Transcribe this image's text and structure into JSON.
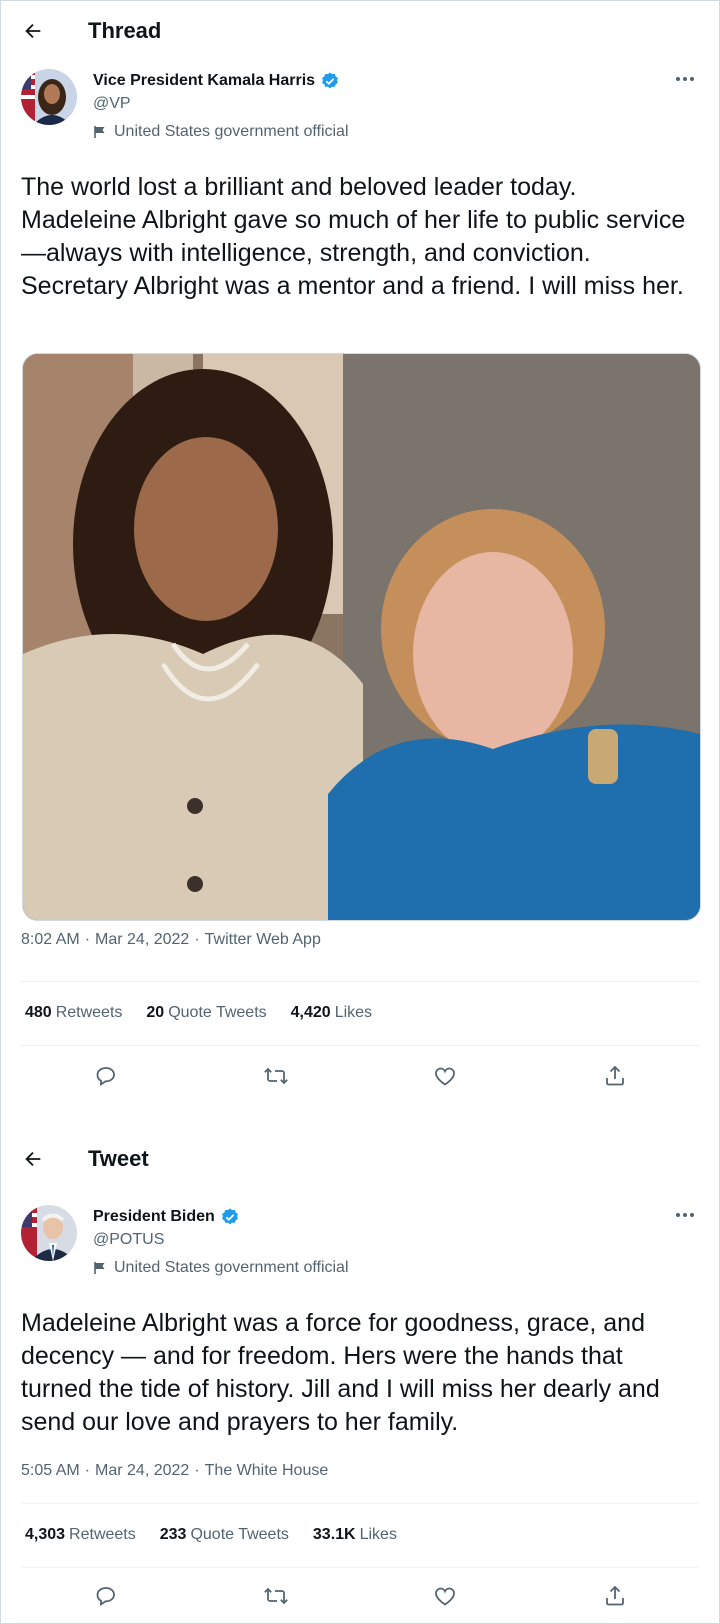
{
  "thread": {
    "header_title": "Thread",
    "author": {
      "name": "Vice President Kamala Harris",
      "handle": "@VP",
      "label": "United States government official"
    },
    "text": "The world lost a brilliant and beloved leader today. Madeleine Albright gave so much of her life to public service—always with intelligence, strength, and conviction. Secretary Albright was a mentor and a friend. I will miss her.",
    "time": "8:02 AM",
    "date": "Mar 24, 2022",
    "source": "Twitter Web App",
    "stats": [
      {
        "num": "480",
        "label": "Retweets"
      },
      {
        "num": "20",
        "label": "Quote Tweets"
      },
      {
        "num": "4,420",
        "label": "Likes"
      }
    ]
  },
  "tweet": {
    "header_title": "Tweet",
    "author": {
      "name": "President Biden",
      "handle": "@POTUS",
      "label": "United States government official"
    },
    "text": "Madeleine Albright was a force for goodness, grace, and decency — and for freedom. Hers were the hands that turned the tide of history. Jill and I will miss her dearly and send our love and prayers to her family.",
    "time": "5:05 AM",
    "date": "Mar 24, 2022",
    "source": "The White House",
    "stats": [
      {
        "num": "4,303",
        "label": "Retweets"
      },
      {
        "num": "233",
        "label": "Quote Tweets"
      },
      {
        "num": "33.1K",
        "label": "Likes"
      }
    ]
  },
  "meta_separator": "·",
  "colors": {
    "text": "#0f1419",
    "secondary": "#536471",
    "verified": "#1d9bf0",
    "divider": "#eff3f4"
  },
  "icons": [
    "back-arrow-icon",
    "verified-badge-icon",
    "flag-icon",
    "more-icon",
    "reply-icon",
    "retweet-icon",
    "like-icon",
    "share-icon"
  ]
}
